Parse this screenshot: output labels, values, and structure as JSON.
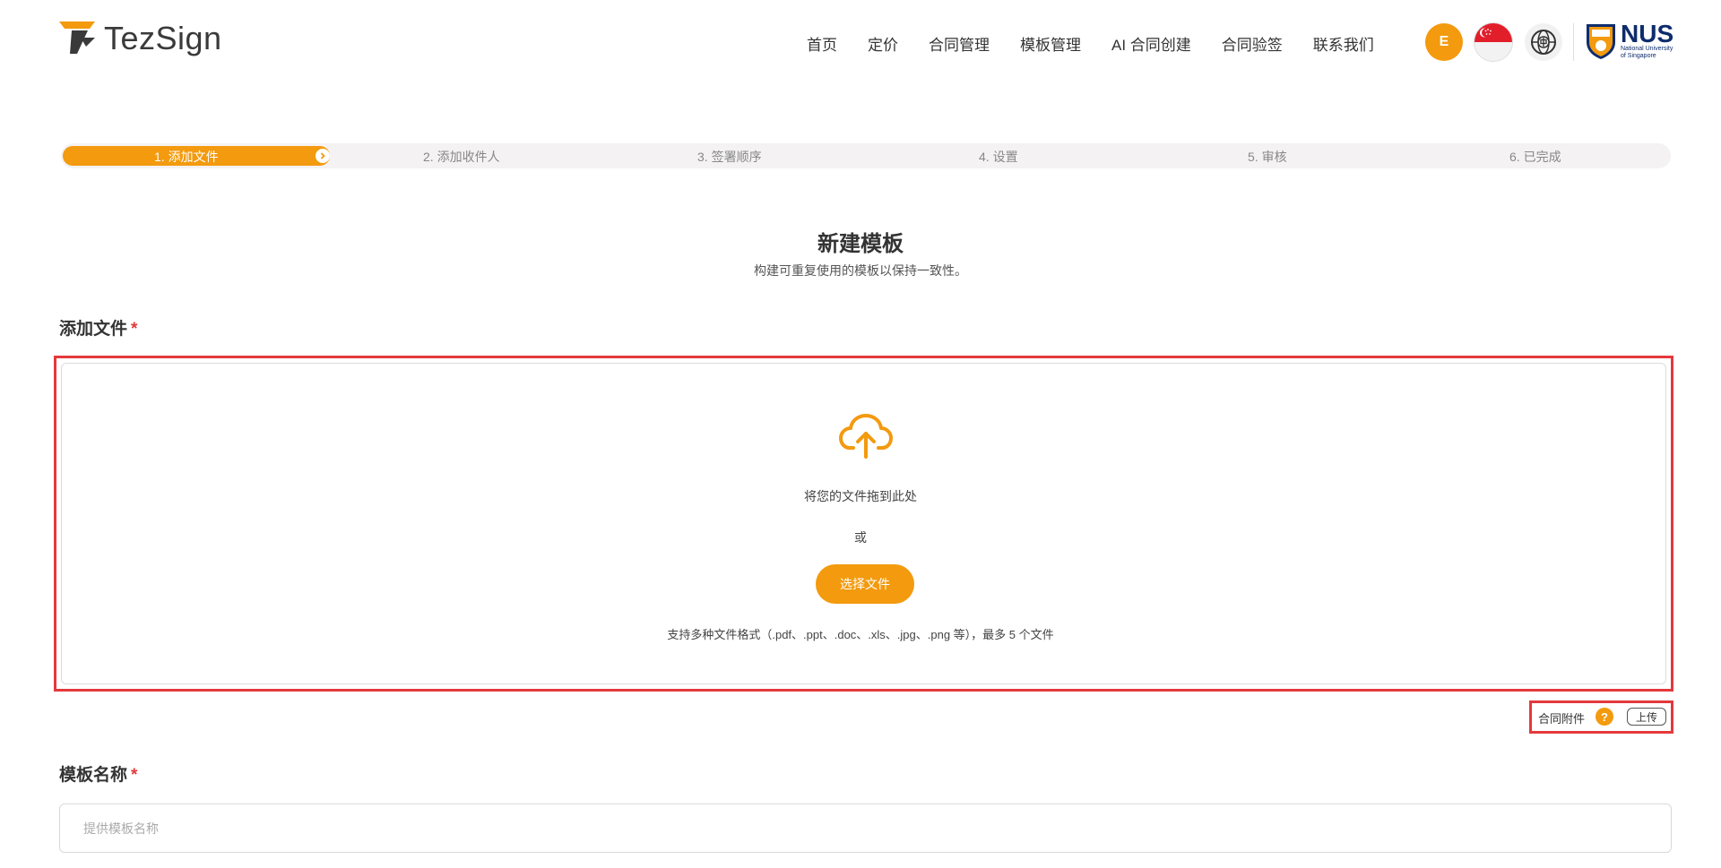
{
  "header": {
    "brand": "TezSign",
    "nav": [
      "首页",
      "定价",
      "合同管理",
      "模板管理",
      "AI 合同创建",
      "合同验签",
      "联系我们"
    ],
    "avatar_initial": "E",
    "partner_logo_text": "NUS",
    "partner_logo_subtext_1": "National University",
    "partner_logo_subtext_2": "of Singapore"
  },
  "steps": [
    {
      "label": "1. 添加文件",
      "active": true
    },
    {
      "label": "2. 添加收件人",
      "active": false
    },
    {
      "label": "3. 签署顺序",
      "active": false
    },
    {
      "label": "4. 设置",
      "active": false
    },
    {
      "label": "5. 审核",
      "active": false
    },
    {
      "label": "6. 已完成",
      "active": false
    }
  ],
  "page": {
    "title": "新建模板",
    "subtitle": "构建可重复使用的模板以保持一致性。"
  },
  "add_file": {
    "label": "添加文件",
    "required_mark": "*",
    "drop_text": "将您的文件拖到此处",
    "or_text": "或",
    "choose_button": "选择文件",
    "support_text": "支持多种文件格式（.pdf、.ppt、.doc、.xls、.jpg、.png 等），最多 5 个文件"
  },
  "attachment": {
    "label": "合同附件",
    "help": "?",
    "upload_button": "上传"
  },
  "template_name": {
    "label": "模板名称",
    "required_mark": "*",
    "placeholder": "提供模板名称"
  },
  "colors": {
    "accent": "#f39a0e",
    "highlight_frame": "#e4393c"
  }
}
